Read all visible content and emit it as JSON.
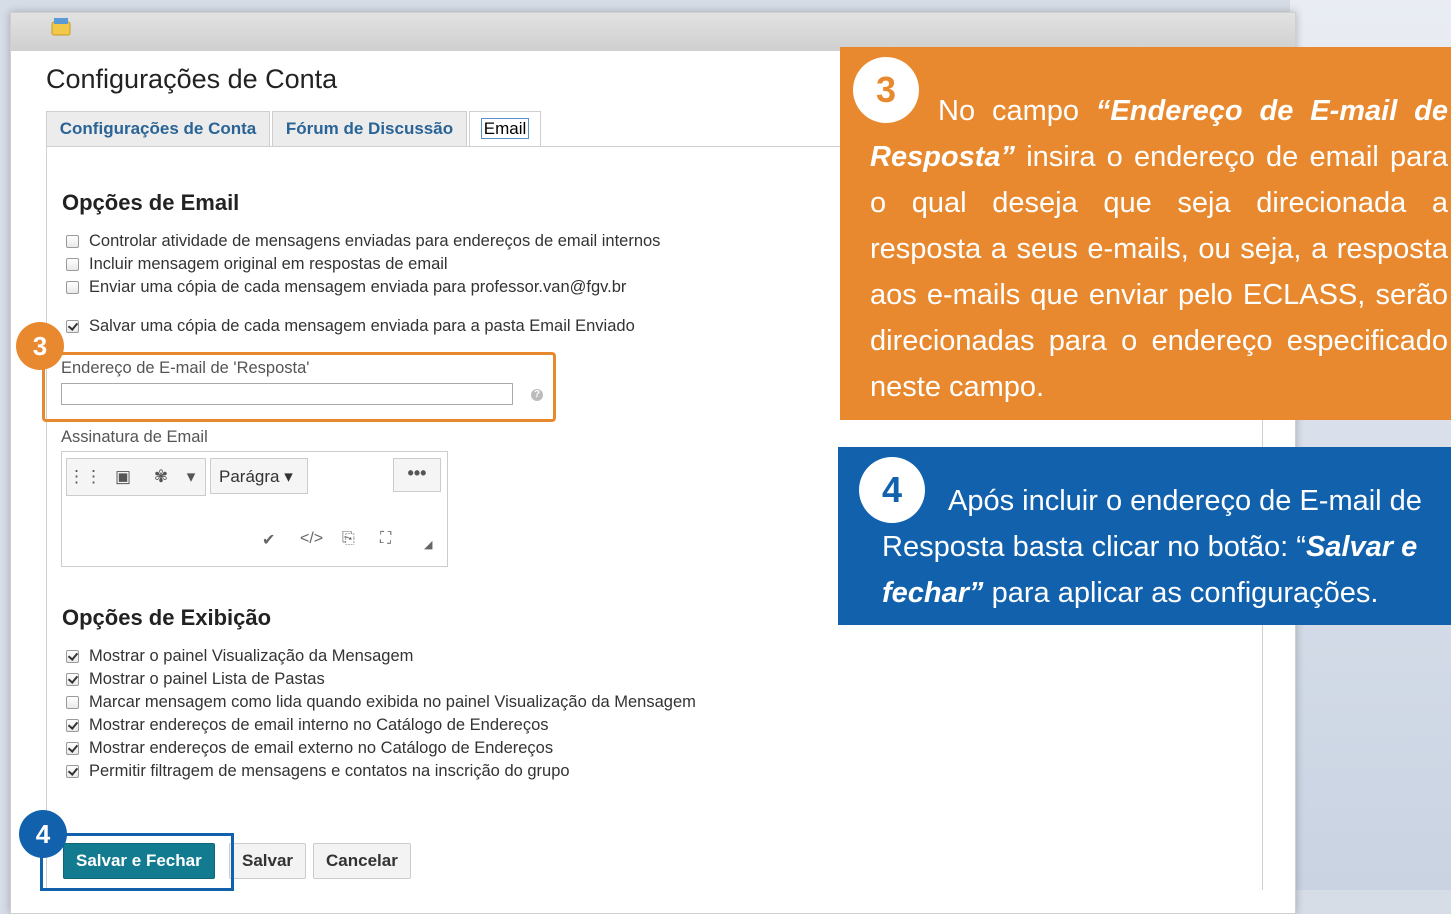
{
  "page_title": "Configurações de Conta",
  "tabs": [
    {
      "label": "Configurações de Conta"
    },
    {
      "label": "Fórum de Discussão"
    },
    {
      "label": "Email"
    }
  ],
  "email_options": {
    "title": "Opções de Email",
    "items": [
      {
        "label": "Controlar atividade de mensagens enviadas para endereços de email internos",
        "checked": false
      },
      {
        "label": "Incluir mensagem original em respostas de email",
        "checked": false
      },
      {
        "label": "Enviar uma cópia de cada mensagem enviada para professor.van@fgv.br",
        "checked": false
      },
      {
        "label": "Salvar uma cópia de cada mensagem enviada para a pasta Email Enviado",
        "checked": true
      }
    ]
  },
  "reply_field": {
    "label": "Endereço de E-mail de 'Resposta'",
    "value": "",
    "help": "?"
  },
  "signature": {
    "label": "Assinatura de Email",
    "format_select": "Parágra",
    "more": "•••"
  },
  "display_options": {
    "title": "Opções de Exibição",
    "items": [
      {
        "label": "Mostrar o painel Visualização da Mensagem",
        "checked": true
      },
      {
        "label": "Mostrar o painel Lista de Pastas",
        "checked": true
      },
      {
        "label": "Marcar mensagem como lida quando exibida no painel Visualização da Mensagem",
        "checked": false
      },
      {
        "label": "Mostrar endereços de email interno no Catálogo de Endereços",
        "checked": true
      },
      {
        "label": "Mostrar endereços de email externo no Catálogo de Endereços",
        "checked": true
      },
      {
        "label": "Permitir filtragem de mensagens e contatos na inscrição do grupo",
        "checked": true
      }
    ]
  },
  "buttons": {
    "save_close": "Salvar e Fechar",
    "save": "Salvar",
    "cancel": "Cancelar"
  },
  "markers": {
    "three": "3",
    "four": "4"
  },
  "callout3": {
    "number": "3",
    "intro": "No campo ",
    "emph": "“Endereço de E-mail de Resposta”",
    "rest": " insira o endereço de email para o qual deseja que seja direcionada a resposta a seus e-mails, ou seja, a resposta aos e-mails que enviar pelo ECLASS, serão direcionadas para o endereço especificado neste campo."
  },
  "callout4": {
    "number": "4",
    "intro": "Após incluir o endereço de E-mail de Resposta basta clicar no botão: “",
    "emph": "Salvar e fechar”",
    "rest": " para aplicar as configurações."
  },
  "colors": {
    "orange": "#e8892f",
    "blue": "#1261ad",
    "primary_button": "#127b8f",
    "tab_link": "#2a6496"
  }
}
